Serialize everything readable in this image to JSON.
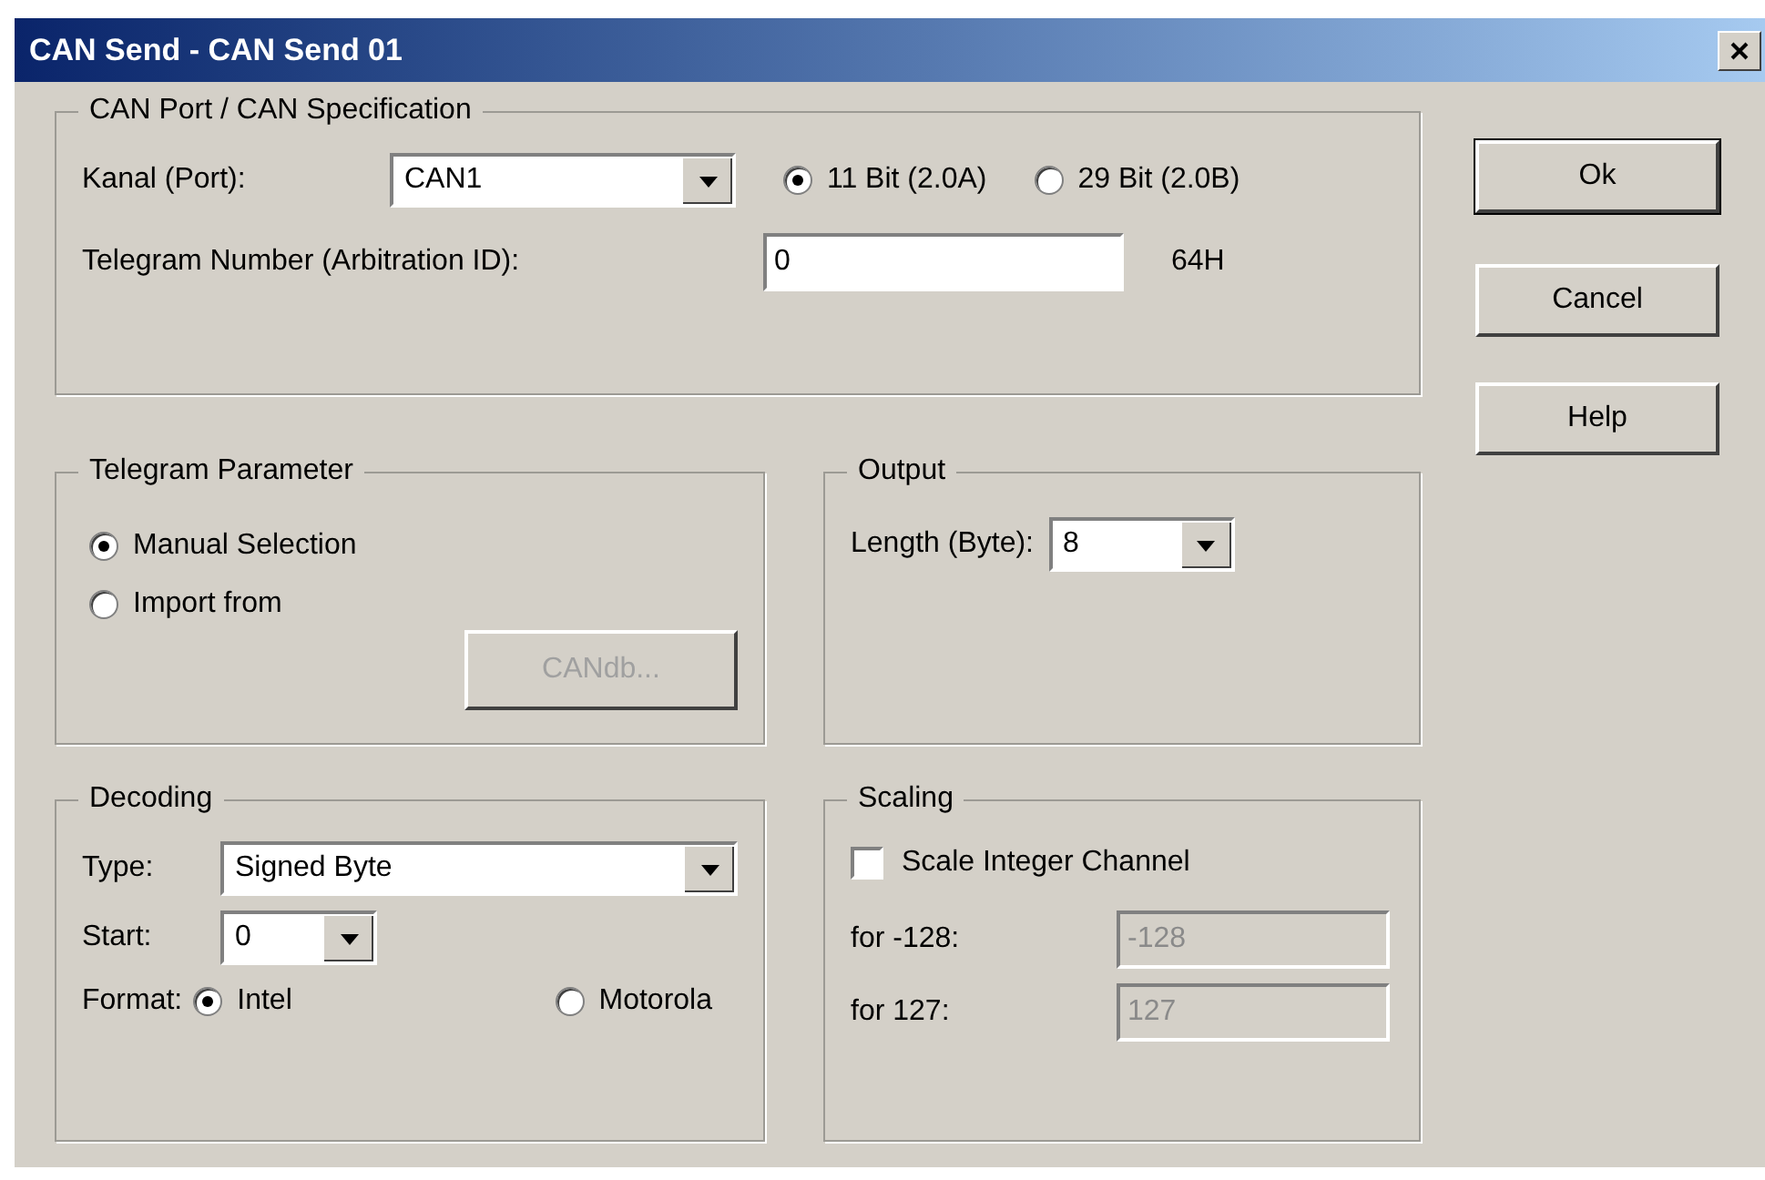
{
  "window": {
    "title": "CAN Send - CAN Send 01"
  },
  "can_port": {
    "title": "CAN Port / CAN Specification",
    "port_label": "Kanal (Port):",
    "port_value": "CAN1",
    "id_modes": [
      {
        "label": "11 Bit (2.0A)",
        "selected": true
      },
      {
        "label": "29 Bit (2.0B)",
        "selected": false
      }
    ],
    "id_label": "Telegram Number (Arbitration ID):",
    "id_value": "0",
    "id_hex": "64H"
  },
  "telegram_parameter": {
    "title": "Telegram Parameter",
    "sources": [
      {
        "label": "Manual Selection",
        "selected": true
      },
      {
        "label": "Import from",
        "selected": false
      }
    ],
    "candb_button": {
      "label": "CANdb...",
      "disabled": true
    }
  },
  "output": {
    "title": "Output",
    "length_label": "Length (Byte):",
    "length_value": "8"
  },
  "decoding": {
    "title": "Decoding",
    "type_label": "Type:",
    "type_value": "Signed Byte",
    "start_label": "Start:",
    "start_value": "0",
    "format_label": "Format:",
    "formats": [
      {
        "label": "Intel",
        "selected": true
      },
      {
        "label": "Motorola",
        "selected": false
      }
    ]
  },
  "scaling": {
    "title": "Scaling",
    "checkbox": {
      "label": "Scale Integer Channel",
      "checked": false
    },
    "fields": [
      {
        "label": "for -128:",
        "value": "-128",
        "disabled": true
      },
      {
        "label": "for 127:",
        "value": "127",
        "disabled": true
      }
    ]
  },
  "buttons": [
    "Ok",
    "Cancel",
    "Help"
  ]
}
